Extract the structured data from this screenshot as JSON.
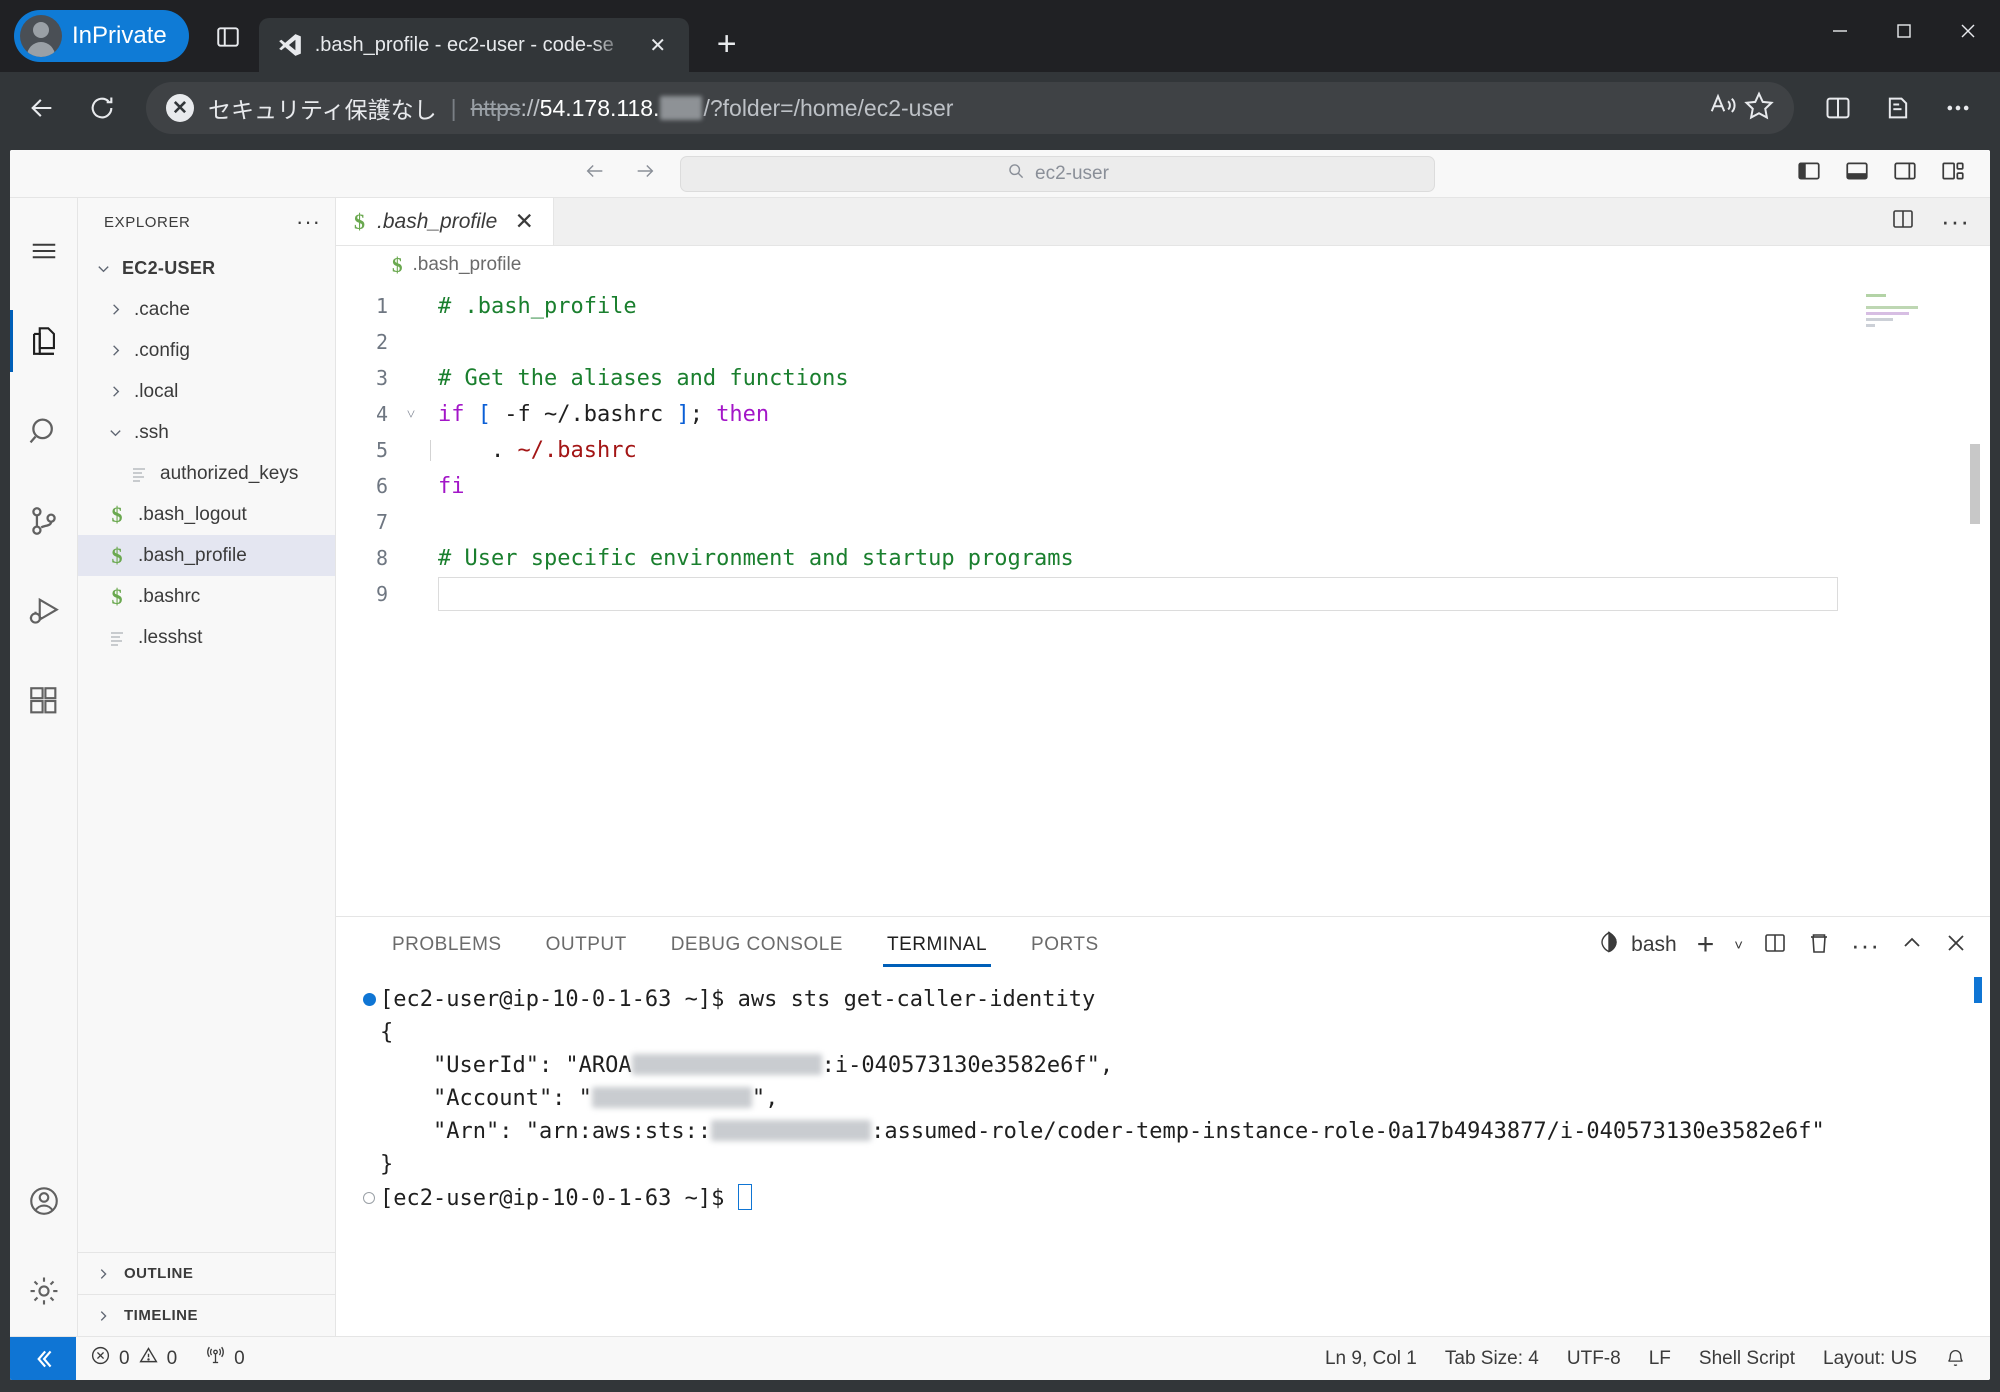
{
  "browser": {
    "profile_label": "InPrivate",
    "tab": {
      "title": ".bash_profile - ec2-user - code-se",
      "icon": "vscode-icon",
      "close_label": "✕"
    },
    "new_tab_label": "+",
    "security_text": "セキュリティ保護なし",
    "separator": "|",
    "url": {
      "scheme": "https",
      "scheme_suffix": "://",
      "host": "54.178.118.",
      "host_redacted": true,
      "path": "/?folder=/home/ec2-user"
    },
    "window_controls": {
      "minimize": "minimize-icon",
      "maximize": "maximize-icon",
      "close": "close-icon"
    }
  },
  "vscode": {
    "command_center": {
      "placeholder": "ec2-user",
      "icon": "search-icon"
    },
    "nav": {
      "back": "back-arrow-icon",
      "forward": "forward-arrow-icon"
    },
    "layout_controls": [
      "toggle-primary-sidebar-icon",
      "toggle-panel-icon",
      "toggle-secondary-sidebar-icon",
      "customize-layout-icon"
    ],
    "activity_bar": [
      {
        "name": "menu",
        "icon": "hamburger-icon",
        "active": false
      },
      {
        "name": "explorer",
        "icon": "files-icon",
        "active": true
      },
      {
        "name": "search",
        "icon": "search-icon",
        "active": false
      },
      {
        "name": "source-control",
        "icon": "source-control-icon",
        "active": false
      },
      {
        "name": "run-and-debug",
        "icon": "run-debug-icon",
        "active": false
      },
      {
        "name": "extensions",
        "icon": "extensions-icon",
        "active": false
      },
      {
        "name": "accounts",
        "icon": "account-icon",
        "active": false
      },
      {
        "name": "manage",
        "icon": "gear-icon",
        "active": false
      }
    ],
    "sidebar": {
      "title": "EXPLORER",
      "more_actions": "···",
      "root": {
        "label": "EC2-USER",
        "expanded": true
      },
      "tree": [
        {
          "label": ".cache",
          "type": "folder",
          "expanded": false,
          "depth": 1,
          "icon": "chevron-right-icon"
        },
        {
          "label": ".config",
          "type": "folder",
          "expanded": false,
          "depth": 1,
          "icon": "chevron-right-icon"
        },
        {
          "label": ".local",
          "type": "folder",
          "expanded": false,
          "depth": 1,
          "icon": "chevron-right-icon"
        },
        {
          "label": ".ssh",
          "type": "folder",
          "expanded": true,
          "depth": 1,
          "icon": "chevron-down-icon"
        },
        {
          "label": "authorized_keys",
          "type": "file",
          "depth": 2,
          "icon": "text-file-icon",
          "selected": false
        },
        {
          "label": ".bash_logout",
          "type": "file",
          "depth": 1,
          "icon": "shell-file-icon",
          "selected": false
        },
        {
          "label": ".bash_profile",
          "type": "file",
          "depth": 1,
          "icon": "shell-file-icon",
          "selected": true
        },
        {
          "label": ".bashrc",
          "type": "file",
          "depth": 1,
          "icon": "shell-file-icon",
          "selected": false
        },
        {
          "label": ".lesshst",
          "type": "file",
          "depth": 1,
          "icon": "text-file-icon",
          "selected": false
        }
      ],
      "sections": [
        {
          "label": "OUTLINE",
          "expanded": false
        },
        {
          "label": "TIMELINE",
          "expanded": false
        }
      ]
    },
    "editor": {
      "tab": {
        "label": ".bash_profile",
        "icon": "shell-file-icon",
        "close": "✕",
        "dirty": false
      },
      "tabbar_actions": {
        "split_editor": "split-editor-icon",
        "more": "···"
      },
      "breadcrumb": ".bash_profile",
      "current_line": 9,
      "lines": [
        {
          "n": 1,
          "fold": "",
          "tokens": [
            {
              "t": "# .bash_profile",
              "c": "cmt"
            }
          ]
        },
        {
          "n": 2,
          "fold": "",
          "tokens": []
        },
        {
          "n": 3,
          "fold": "",
          "tokens": [
            {
              "t": "# Get the aliases and functions",
              "c": "cmt"
            }
          ]
        },
        {
          "n": 4,
          "fold": "v",
          "tokens": [
            {
              "t": "if ",
              "c": "kw"
            },
            {
              "t": "[",
              "c": "br"
            },
            {
              "t": " -f ~/.bashrc ",
              "c": "pln"
            },
            {
              "t": "]",
              "c": "br"
            },
            {
              "t": "; ",
              "c": "pln"
            },
            {
              "t": "then",
              "c": "kw"
            }
          ]
        },
        {
          "n": 5,
          "fold": "",
          "tokens": [
            {
              "t": "    . ",
              "c": "pln"
            },
            {
              "t": "~/.bashrc",
              "c": "str"
            }
          ]
        },
        {
          "n": 6,
          "fold": "",
          "tokens": [
            {
              "t": "fi",
              "c": "kw"
            }
          ]
        },
        {
          "n": 7,
          "fold": "",
          "tokens": []
        },
        {
          "n": 8,
          "fold": "",
          "tokens": [
            {
              "t": "# User specific environment and startup programs",
              "c": "cmt"
            }
          ]
        },
        {
          "n": 9,
          "fold": "",
          "tokens": []
        }
      ]
    },
    "panel": {
      "tabs": [
        {
          "label": "PROBLEMS",
          "active": false
        },
        {
          "label": "OUTPUT",
          "active": false
        },
        {
          "label": "DEBUG CONSOLE",
          "active": false
        },
        {
          "label": "TERMINAL",
          "active": true
        },
        {
          "label": "PORTS",
          "active": false
        }
      ],
      "actions": {
        "shell_label": "bash",
        "shell_icon": "bash-icon",
        "new_terminal": "+",
        "new_terminal_dropdown": "chevron-down-icon",
        "split_terminal": "split-terminal-icon",
        "kill_terminal": "trash-icon",
        "more": "···",
        "maximize_panel": "chevron-up-icon",
        "close_panel": "close-icon"
      },
      "terminal_lines": [
        {
          "marker": "filled",
          "segments": [
            {
              "t": "[ec2-user@ip-10-0-1-63 ~]$ aws sts get-caller-identity"
            }
          ]
        },
        {
          "marker": "none",
          "segments": [
            {
              "t": "{"
            }
          ]
        },
        {
          "marker": "none",
          "segments": [
            {
              "t": "    \"UserId\": \"AROA"
            },
            {
              "redact": 190
            },
            {
              "t": ":i-040573130e3582e6f\","
            }
          ]
        },
        {
          "marker": "none",
          "segments": [
            {
              "t": "    \"Account\": \""
            },
            {
              "redact": 160
            },
            {
              "t": "\","
            }
          ]
        },
        {
          "marker": "none",
          "segments": [
            {
              "t": "    \"Arn\": \"arn:aws:sts::"
            },
            {
              "redact": 160
            },
            {
              "t": ":assumed-role/coder-temp-instance-role-0a17b4943877/i-040573130e3582e6f\""
            }
          ]
        },
        {
          "marker": "none",
          "segments": [
            {
              "t": "}"
            }
          ]
        },
        {
          "marker": "hollow",
          "segments": [
            {
              "t": "[ec2-user@ip-10-0-1-63 ~]$ "
            },
            {
              "cursor": true
            }
          ]
        }
      ]
    },
    "statusbar": {
      "remote_icon": "remote-window-icon",
      "left": [
        {
          "icon": "error-icon",
          "value": "0"
        },
        {
          "icon": "warning-icon",
          "value": "0"
        },
        {
          "icon": "ports-icon",
          "value": "0"
        }
      ],
      "right": [
        {
          "label": "Ln 9, Col 1"
        },
        {
          "label": "Tab Size: 4"
        },
        {
          "label": "UTF-8"
        },
        {
          "label": "LF"
        },
        {
          "label": "Shell Script"
        },
        {
          "label": "Layout: US"
        }
      ],
      "bell_icon": "bell-icon"
    }
  },
  "colors": {
    "accent": "#005fb8",
    "remote_blue": "#0f75d4",
    "comment_green": "#1a7f2e",
    "keyword_purple": "#a316c8",
    "string_red": "#a31515",
    "bracket_blue": "#0b5fd6",
    "inprivate_blue": "#0f7bd6"
  }
}
